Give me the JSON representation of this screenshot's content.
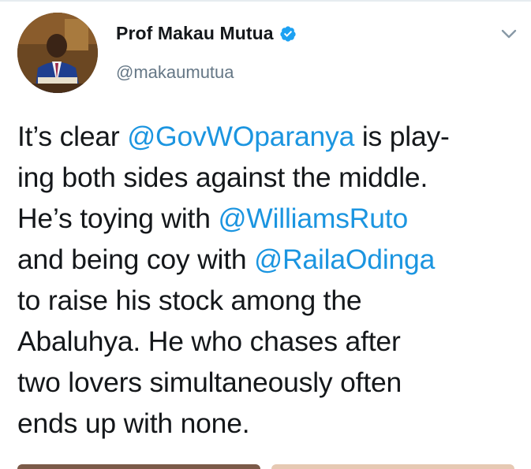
{
  "user": {
    "display_name": "Prof Makau Mutua",
    "handle": "@makaumutua",
    "verified": true,
    "avatar_icon": "profile-photo"
  },
  "tweet": {
    "lines": [
      [
        {
          "t": "It’s clear ",
          "m": false
        },
        {
          "t": "@GovWOparanya",
          "m": true
        },
        {
          "t": " is play-",
          "m": false
        }
      ],
      [
        {
          "t": "ing both sides against the middle.",
          "m": false
        }
      ],
      [
        {
          "t": "He’s toying with ",
          "m": false
        },
        {
          "t": "@WilliamsRuto",
          "m": true
        }
      ],
      [
        {
          "t": "and being coy with ",
          "m": false
        },
        {
          "t": "@RailaOdinga",
          "m": true
        }
      ],
      [
        {
          "t": "to raise his stock among the",
          "m": false
        }
      ],
      [
        {
          "t": "Abaluhya.  He who chases after",
          "m": false
        }
      ],
      [
        {
          "t": "two lovers simultaneously often",
          "m": false
        }
      ],
      [
        {
          "t": "ends up with none.",
          "m": false
        }
      ]
    ]
  },
  "colors": {
    "mention": "#1b95e0",
    "text": "#14171a",
    "secondary": "#657786",
    "verified_badge": "#1da1f2"
  },
  "icons": {
    "more_menu": "chevron-down-icon",
    "verified": "verified-badge-icon"
  }
}
